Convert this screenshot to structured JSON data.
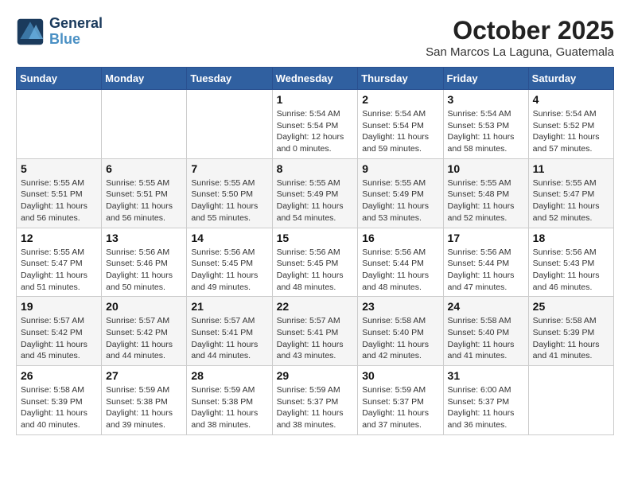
{
  "header": {
    "logo_line1": "General",
    "logo_line2": "Blue",
    "month_title": "October 2025",
    "location": "San Marcos La Laguna, Guatemala"
  },
  "weekdays": [
    "Sunday",
    "Monday",
    "Tuesday",
    "Wednesday",
    "Thursday",
    "Friday",
    "Saturday"
  ],
  "weeks": [
    [
      {
        "day": "",
        "info": ""
      },
      {
        "day": "",
        "info": ""
      },
      {
        "day": "",
        "info": ""
      },
      {
        "day": "1",
        "info": "Sunrise: 5:54 AM\nSunset: 5:54 PM\nDaylight: 12 hours\nand 0 minutes."
      },
      {
        "day": "2",
        "info": "Sunrise: 5:54 AM\nSunset: 5:54 PM\nDaylight: 11 hours\nand 59 minutes."
      },
      {
        "day": "3",
        "info": "Sunrise: 5:54 AM\nSunset: 5:53 PM\nDaylight: 11 hours\nand 58 minutes."
      },
      {
        "day": "4",
        "info": "Sunrise: 5:54 AM\nSunset: 5:52 PM\nDaylight: 11 hours\nand 57 minutes."
      }
    ],
    [
      {
        "day": "5",
        "info": "Sunrise: 5:55 AM\nSunset: 5:51 PM\nDaylight: 11 hours\nand 56 minutes."
      },
      {
        "day": "6",
        "info": "Sunrise: 5:55 AM\nSunset: 5:51 PM\nDaylight: 11 hours\nand 56 minutes."
      },
      {
        "day": "7",
        "info": "Sunrise: 5:55 AM\nSunset: 5:50 PM\nDaylight: 11 hours\nand 55 minutes."
      },
      {
        "day": "8",
        "info": "Sunrise: 5:55 AM\nSunset: 5:49 PM\nDaylight: 11 hours\nand 54 minutes."
      },
      {
        "day": "9",
        "info": "Sunrise: 5:55 AM\nSunset: 5:49 PM\nDaylight: 11 hours\nand 53 minutes."
      },
      {
        "day": "10",
        "info": "Sunrise: 5:55 AM\nSunset: 5:48 PM\nDaylight: 11 hours\nand 52 minutes."
      },
      {
        "day": "11",
        "info": "Sunrise: 5:55 AM\nSunset: 5:47 PM\nDaylight: 11 hours\nand 52 minutes."
      }
    ],
    [
      {
        "day": "12",
        "info": "Sunrise: 5:55 AM\nSunset: 5:47 PM\nDaylight: 11 hours\nand 51 minutes."
      },
      {
        "day": "13",
        "info": "Sunrise: 5:56 AM\nSunset: 5:46 PM\nDaylight: 11 hours\nand 50 minutes."
      },
      {
        "day": "14",
        "info": "Sunrise: 5:56 AM\nSunset: 5:45 PM\nDaylight: 11 hours\nand 49 minutes."
      },
      {
        "day": "15",
        "info": "Sunrise: 5:56 AM\nSunset: 5:45 PM\nDaylight: 11 hours\nand 48 minutes."
      },
      {
        "day": "16",
        "info": "Sunrise: 5:56 AM\nSunset: 5:44 PM\nDaylight: 11 hours\nand 48 minutes."
      },
      {
        "day": "17",
        "info": "Sunrise: 5:56 AM\nSunset: 5:44 PM\nDaylight: 11 hours\nand 47 minutes."
      },
      {
        "day": "18",
        "info": "Sunrise: 5:56 AM\nSunset: 5:43 PM\nDaylight: 11 hours\nand 46 minutes."
      }
    ],
    [
      {
        "day": "19",
        "info": "Sunrise: 5:57 AM\nSunset: 5:42 PM\nDaylight: 11 hours\nand 45 minutes."
      },
      {
        "day": "20",
        "info": "Sunrise: 5:57 AM\nSunset: 5:42 PM\nDaylight: 11 hours\nand 44 minutes."
      },
      {
        "day": "21",
        "info": "Sunrise: 5:57 AM\nSunset: 5:41 PM\nDaylight: 11 hours\nand 44 minutes."
      },
      {
        "day": "22",
        "info": "Sunrise: 5:57 AM\nSunset: 5:41 PM\nDaylight: 11 hours\nand 43 minutes."
      },
      {
        "day": "23",
        "info": "Sunrise: 5:58 AM\nSunset: 5:40 PM\nDaylight: 11 hours\nand 42 minutes."
      },
      {
        "day": "24",
        "info": "Sunrise: 5:58 AM\nSunset: 5:40 PM\nDaylight: 11 hours\nand 41 minutes."
      },
      {
        "day": "25",
        "info": "Sunrise: 5:58 AM\nSunset: 5:39 PM\nDaylight: 11 hours\nand 41 minutes."
      }
    ],
    [
      {
        "day": "26",
        "info": "Sunrise: 5:58 AM\nSunset: 5:39 PM\nDaylight: 11 hours\nand 40 minutes."
      },
      {
        "day": "27",
        "info": "Sunrise: 5:59 AM\nSunset: 5:38 PM\nDaylight: 11 hours\nand 39 minutes."
      },
      {
        "day": "28",
        "info": "Sunrise: 5:59 AM\nSunset: 5:38 PM\nDaylight: 11 hours\nand 38 minutes."
      },
      {
        "day": "29",
        "info": "Sunrise: 5:59 AM\nSunset: 5:37 PM\nDaylight: 11 hours\nand 38 minutes."
      },
      {
        "day": "30",
        "info": "Sunrise: 5:59 AM\nSunset: 5:37 PM\nDaylight: 11 hours\nand 37 minutes."
      },
      {
        "day": "31",
        "info": "Sunrise: 6:00 AM\nSunset: 5:37 PM\nDaylight: 11 hours\nand 36 minutes."
      },
      {
        "day": "",
        "info": ""
      }
    ]
  ]
}
